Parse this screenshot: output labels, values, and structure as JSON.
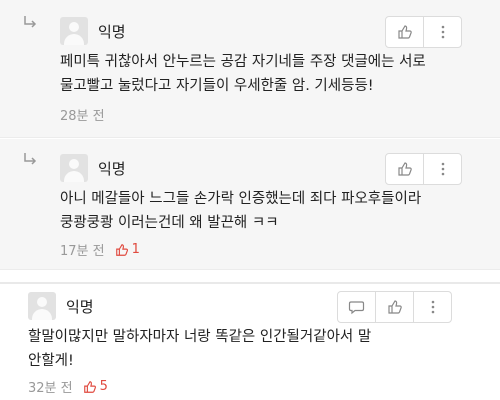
{
  "comments": [
    {
      "author": "익명",
      "lines": [
        "페미특 귀찮아서 안누르는 공감 자기네들 주장 댓글에는 서로",
        "물고빨고 눌렀다고 자기들이 우세한줄 암. 기세등등!"
      ],
      "time": "28분 전",
      "likes": ""
    },
    {
      "author": "익명",
      "lines": [
        "아니 메갈들아 느그들 손가락 인증했는데 죄다 파오후들이라",
        "쿵쾅쿵쾅 이러는건데 왜 발끈해 ㅋㅋ"
      ],
      "time": "17분 전",
      "likes": "1"
    },
    {
      "author": "익명",
      "lines": [
        "할말이많지만 말하자마자 너랑 똑같은 인간될거같아서 말",
        "안할게!"
      ],
      "time": "32분 전",
      "likes": "5"
    }
  ],
  "colors": {
    "like": "#e04a3f",
    "reply_bg": "#f6f6f6",
    "meta": "#999999"
  },
  "icons": [
    "reply-arrow-icon",
    "avatar-icon",
    "thumbs-up-icon",
    "more-vert-icon",
    "speech-bubble-icon"
  ]
}
